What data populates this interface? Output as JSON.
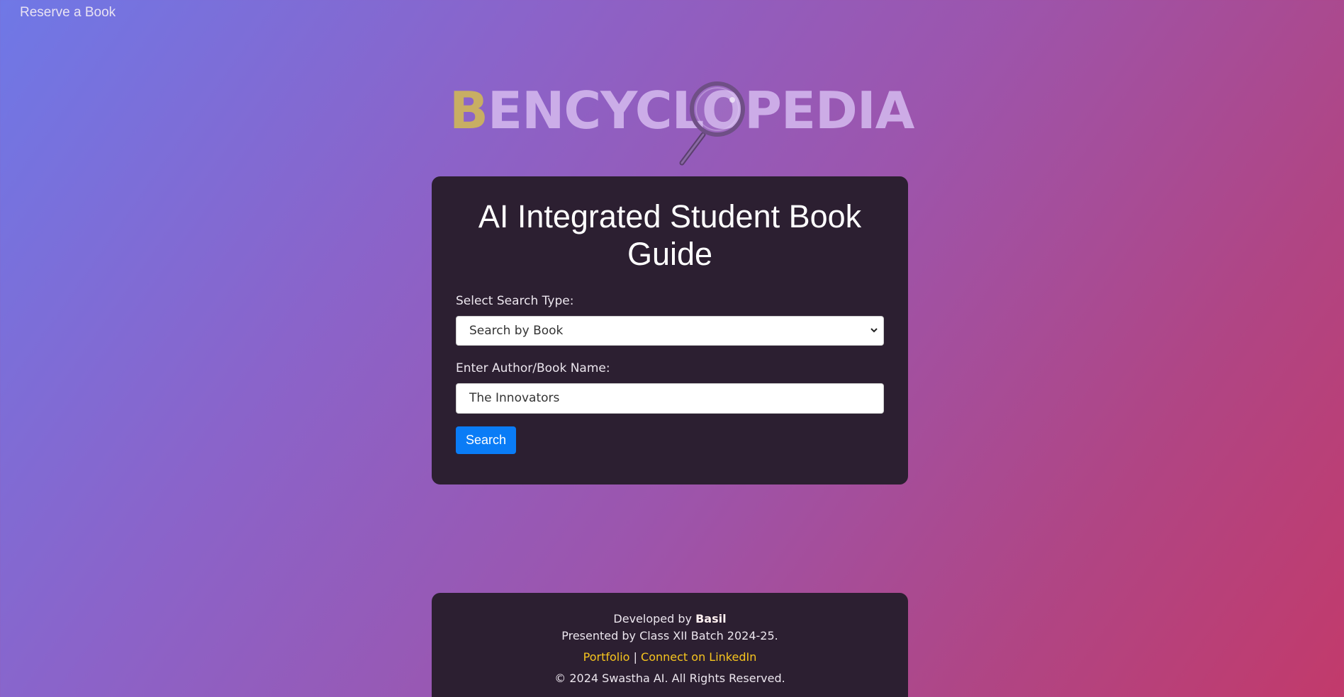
{
  "nav": {
    "reserve_link": "Reserve a Book"
  },
  "logo": {
    "first_letter": "B",
    "rest": "ENCYCLOPEDIA",
    "colors": {
      "first_letter": "#c8ae63",
      "rest": "#d4b8ee"
    }
  },
  "card": {
    "title": "AI Integrated Student Book Guide",
    "search_type_label": "Select Search Type:",
    "search_type_value": "Search by Book",
    "name_label": "Enter Author/Book Name:",
    "name_value": "The Innovators",
    "search_button": "Search"
  },
  "footer": {
    "developed_prefix": "Developed by",
    "developer": "Basil",
    "presented": "Presented by Class XII Batch 2024-25.",
    "portfolio_link": "Portfolio",
    "separator": "|",
    "linkedin_link": "Connect on LinkedIn",
    "copyright": "© 2024 Swastha AI. All Rights Reserved."
  },
  "colors": {
    "card_bg": "#2c1f31",
    "button": "#0a7cf6",
    "link": "#f7c51e"
  }
}
